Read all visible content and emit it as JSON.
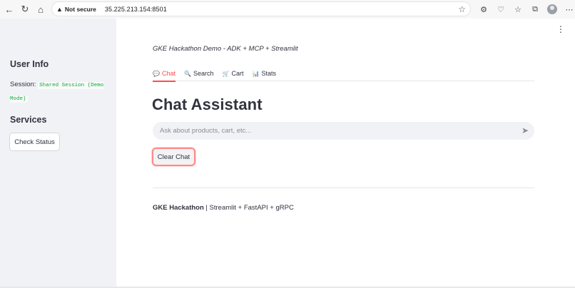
{
  "browser": {
    "security_label": "Not secure",
    "url": "35.225.213.154:8501"
  },
  "sidebar": {
    "user_info_heading": "User Info",
    "session_label": "Session:",
    "session_value": "Shared Session (Demo Mode)",
    "services_heading": "Services",
    "check_status_label": "Check Status"
  },
  "main": {
    "caption": "GKE Hackathon Demo - ADK + MCP + Streamlit",
    "tabs": [
      {
        "icon": "💬",
        "label": "Chat",
        "active": true
      },
      {
        "icon": "🔍",
        "label": "Search",
        "active": false
      },
      {
        "icon": "🛒",
        "label": "Cart",
        "active": false
      },
      {
        "icon": "📊",
        "label": "Stats",
        "active": false
      }
    ],
    "title": "Chat Assistant",
    "chat_placeholder": "Ask about products, cart, etc...",
    "clear_chat_label": "Clear Chat",
    "footer_bold": "GKE Hackathon",
    "footer_rest": " | Streamlit + FastAPI + gRPC"
  },
  "colors": {
    "accent": "#ff4b4b",
    "sidebar_bg": "#f0f2f6",
    "code_green": "#09ab3b"
  }
}
